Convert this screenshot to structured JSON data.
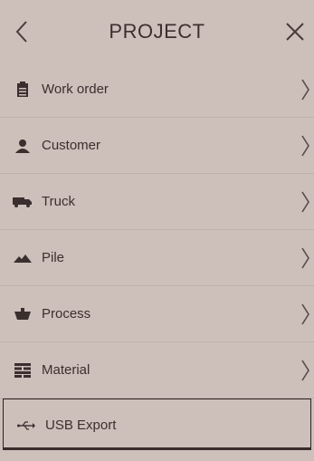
{
  "header": {
    "title": "PROJECT",
    "back_icon": "chevron-left-icon",
    "close_icon": "close-icon"
  },
  "menu": {
    "items": [
      {
        "label": "Work order",
        "icon": "clipboard-icon"
      },
      {
        "label": "Customer",
        "icon": "person-icon"
      },
      {
        "label": "Truck",
        "icon": "truck-icon"
      },
      {
        "label": "Pile",
        "icon": "pile-icon"
      },
      {
        "label": "Process",
        "icon": "process-icon"
      },
      {
        "label": "Material",
        "icon": "material-icon"
      },
      {
        "label": "USB Export",
        "icon": "usb-icon"
      }
    ]
  },
  "colors": {
    "background": "#cdc0bb",
    "text": "#3a2c2c",
    "divider": "#bfb1ad"
  }
}
